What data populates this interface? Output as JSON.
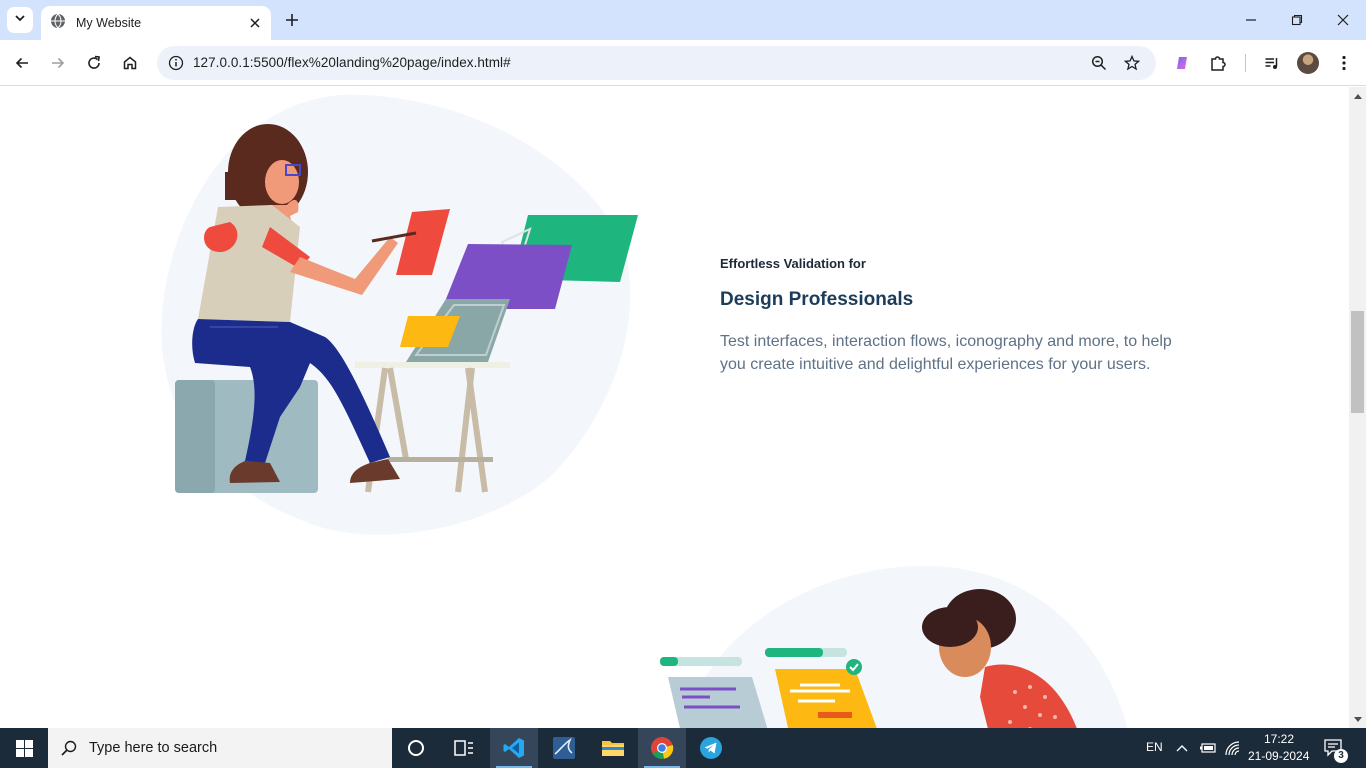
{
  "browser": {
    "tab_title": "My Website",
    "url": "127.0.0.1:5500/flex%20landing%20page/index.html#"
  },
  "page": {
    "feature": {
      "eyebrow": "Effortless Validation for",
      "heading": "Design Professionals",
      "description": "Test interfaces, interaction flows, iconography and more, to help you create intuitive and delightful experiences for your users."
    }
  },
  "taskbar": {
    "search_placeholder": "Type here to search",
    "language": "EN",
    "time": "17:22",
    "date": "21-09-2024",
    "notification_count": "3"
  },
  "colors": {
    "tabbar_bg": "#d3e3fd",
    "omnibox_bg": "#edf2fa",
    "heading": "#1c3d5a",
    "description": "#5f7186",
    "taskbar_bg": "#1c2b3a",
    "blob_bg": "#f3f6fb"
  }
}
